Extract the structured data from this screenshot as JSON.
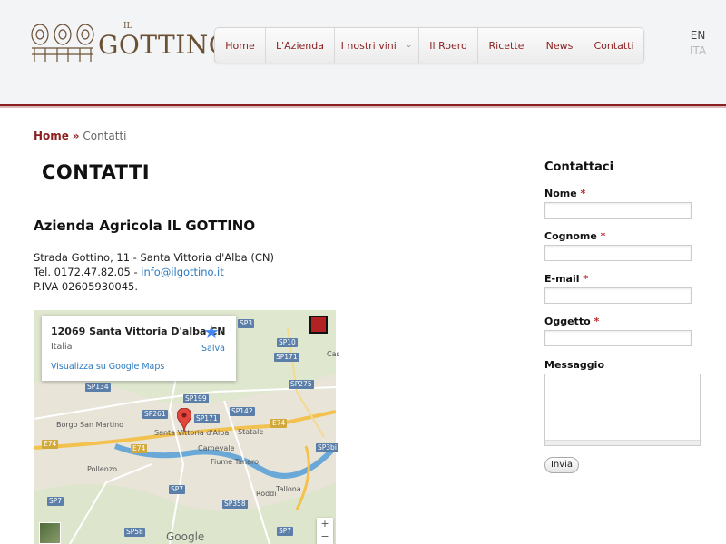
{
  "header": {
    "logo_prefix": "IL",
    "logo_text": "GOTTINO",
    "nav": [
      {
        "label": "Home"
      },
      {
        "label": "L'Azienda"
      },
      {
        "label": "I nostri vini"
      },
      {
        "label": "Il Roero"
      },
      {
        "label": "Ricette"
      },
      {
        "label": "News"
      },
      {
        "label": "Contatti"
      }
    ],
    "languages": {
      "current": "EN",
      "other": "ITA"
    }
  },
  "breadcrumb": {
    "home": "Home",
    "separator": "»",
    "current": "Contatti"
  },
  "main": {
    "title": "CONTATTI",
    "company": "Azienda Agricola IL GOTTINO",
    "address_line": "Strada Gottino, 11 - Santa Vittoria d'Alba (CN)",
    "phone_prefix": "Tel. 0172.47.82.05 - ",
    "email": "info@ilgottino.it",
    "vat": "P.IVA 02605930045."
  },
  "map": {
    "card_address": "12069 Santa Vittoria D'alba CN",
    "card_country": "Italia",
    "card_link": "Visualizza su Google Maps",
    "card_save": "Salva",
    "road_labels": {
      "sp3a": "SP3",
      "sp10": "SP10",
      "sp171a": "SP171",
      "sp134": "SP134",
      "sp275": "SP275",
      "sp199": "SP199",
      "sp261": "SP261",
      "sp171b": "SP171",
      "sp142": "SP142",
      "e74a": "E74",
      "e74b": "E74",
      "e74c": "E74",
      "sp3bis": "SP3bi",
      "sp7a": "SP7",
      "sp7b": "SP7",
      "sp358": "SP358",
      "sp58": "SP58",
      "sp7c": "SP7"
    },
    "towns": {
      "borgo": "Borgo San Martino",
      "vittoria": "Santa Vittoria d'Alba",
      "carnevale": "Carnevale",
      "statale": "Statale",
      "fiume": "Fiume Tanaro",
      "pollenzo": "Pollenzo",
      "roddi": "Roddi",
      "tallona": "Tallona",
      "cas": "Cas"
    },
    "google": "Google",
    "zoom_in": "+",
    "zoom_out": "−"
  },
  "sidebar": {
    "title": "Contattaci",
    "fields": [
      {
        "label": "Nome",
        "required": "*"
      },
      {
        "label": "Cognome",
        "required": "*"
      },
      {
        "label": "E-mail",
        "required": "*"
      },
      {
        "label": "Oggetto",
        "required": "*"
      }
    ],
    "message_label": "Messaggio",
    "send": "Invia"
  },
  "colors": {
    "brand": "#8b1f1f",
    "link": "#2a7ac0",
    "required": "#c0282d"
  }
}
